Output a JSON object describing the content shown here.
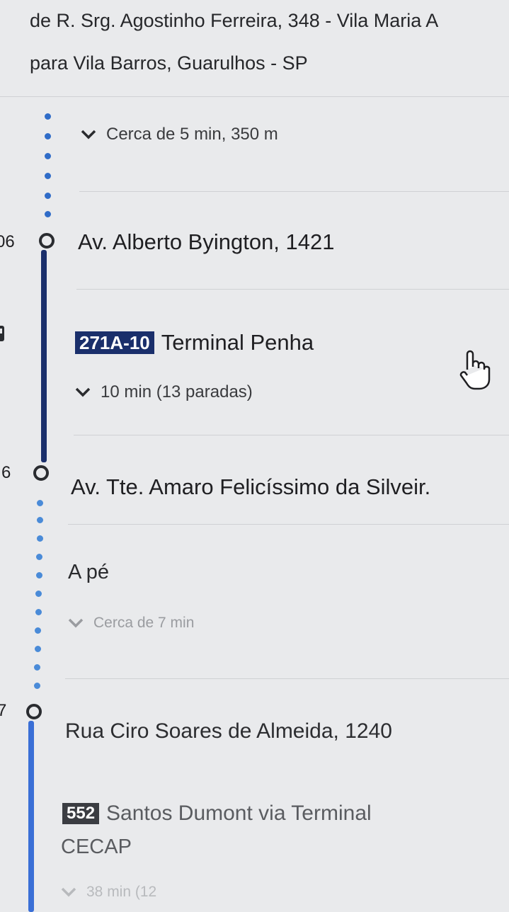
{
  "header": {
    "from_line": "de R. Srg. Agostinho Ferreira, 348 - Vila Maria A",
    "to_line": "para Vila Barros, Guarulhos - SP"
  },
  "steps": {
    "walk1": {
      "summary": "Cerca de 5 min, 350 m"
    },
    "stop1": {
      "time": "06",
      "name": "Av. Alberto Byington, 1421"
    },
    "bus1": {
      "badge": "271A-10",
      "badge_color": "#1a2f6b",
      "destination": "Terminal Penha",
      "summary": "10 min (13 paradas)"
    },
    "stop2": {
      "time": "6",
      "name": "Av. Tte. Amaro Felicíssimo da Silveir."
    },
    "walk2": {
      "label": "A pé",
      "summary": "Cerca de 7 min"
    },
    "stop3": {
      "time": "7",
      "name": "Rua Ciro Soares de Almeida, 1240"
    },
    "bus2": {
      "badge": "552",
      "badge_color": "#3b3d42",
      "destination": "Santos Dumont via Terminal",
      "destination_line2": "CECAP",
      "summary": "38 min (12"
    }
  },
  "icons": {
    "expand": "chevron-down-icon",
    "cursor": "hand-pointer-icon",
    "bus": "bus-icon"
  },
  "colors": {
    "walk_dots": "#2f6cc8",
    "bus1_line": "#1a2f6b",
    "bus2_line": "#3a6fd6"
  }
}
